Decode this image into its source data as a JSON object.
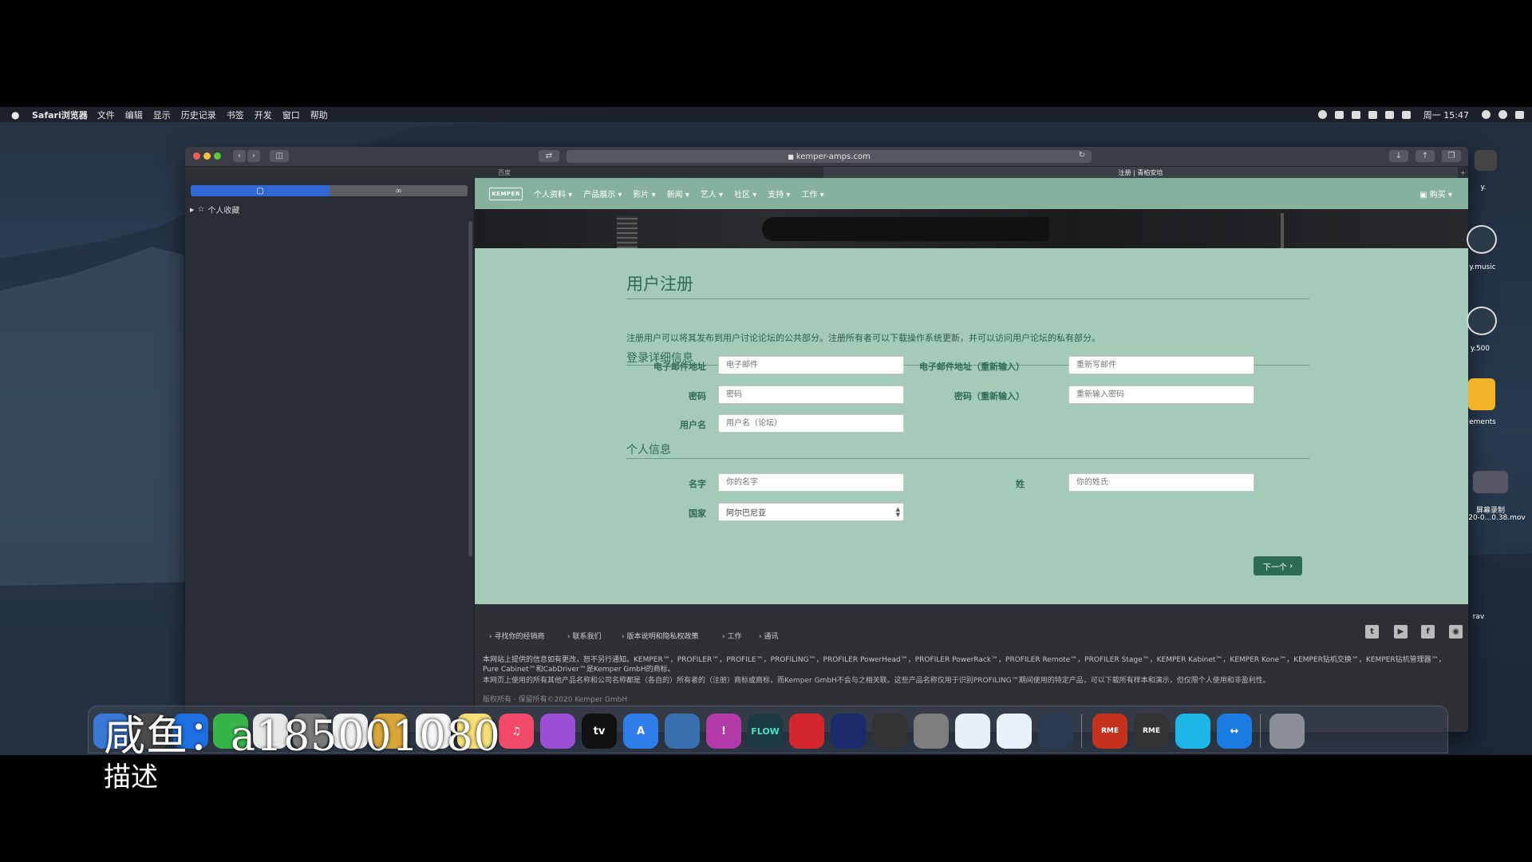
{
  "menubar": {
    "app_name": "Safari浏览器",
    "items": [
      "文件",
      "编辑",
      "显示",
      "历史记录",
      "书签",
      "开发",
      "窗口",
      "帮助"
    ],
    "clock": "周一 15:47"
  },
  "browser": {
    "url": "kemper-amps.com",
    "tabs": [
      "百度",
      "注册 | 青柏安培"
    ]
  },
  "sidebar": {
    "favorites_label": "个人收藏"
  },
  "site": {
    "logo": "KEMPER",
    "nav": [
      "个人资料",
      "产品展示",
      "影片",
      "新闻",
      "艺人",
      "社区",
      "支持",
      "工作"
    ],
    "cart": "购买"
  },
  "form": {
    "title": "用户注册",
    "intro": "注册用户可以将其发布到用户讨论论坛的公共部分。注册所有者可以下载操作系统更新，并可以访问用户论坛的私有部分。",
    "section_login": "登录详细信息",
    "section_personal": "个人信息",
    "fields": {
      "email": {
        "label": "电子邮件地址",
        "placeholder": "电子邮件"
      },
      "email_confirm": {
        "label": "电子邮件地址（重新输入）",
        "placeholder": "重新写邮件"
      },
      "password": {
        "label": "密码",
        "placeholder": "密码"
      },
      "password_confirm": {
        "label": "密码（重新输入）",
        "placeholder": "重新输入密码"
      },
      "username": {
        "label": "用户名",
        "placeholder": "用户名（论坛）"
      },
      "first_name": {
        "label": "名字",
        "placeholder": "你的名字"
      },
      "last_name": {
        "label": "姓",
        "placeholder": "你的姓氏"
      },
      "country": {
        "label": "国家",
        "value": "阿尔巴尼亚"
      }
    },
    "next_button": "下一个"
  },
  "footer": {
    "links": [
      "寻找你的经销商",
      "联系我们",
      "版本说明和隐私权政策",
      "工作",
      "通讯"
    ],
    "legal_1": "本网站上提供的信息如有更改，恕不另行通知。KEMPER™，PROFILER™，PROFILE™，PROFILING™，PROFILER PowerHead™，PROFILER PowerRack™，PROFILER Remote™，PROFILER Stage™，KEMPER Kabinet™，KEMPER Kone™，KEMPER钻机交换™，KEMPER钻机管理器™，Pure Cabinet™和CabDriver™是Kemper GmbH的商标。",
    "legal_2": "本网页上使用的所有其他产品名称和公司名称都是（各自的）所有者的（注册）商标或商标，而Kemper GmbH不会与之相关联。这些产品名称仅用于识别PROFILING™期间使用的特定产品，可以下载所有样本和演示，但仅限个人使用和非盈利性。",
    "copyright": "版权所有 · 保留所有©2020 Kemper GmbH"
  },
  "desktop_labels": [
    "y.",
    "y.music",
    "y.500",
    "ements",
    "屏幕录制",
    "20-0...0.38.mov",
    "rav"
  ],
  "overlay": {
    "watermark": "咸鱼：a185001080",
    "caption": "描述"
  }
}
